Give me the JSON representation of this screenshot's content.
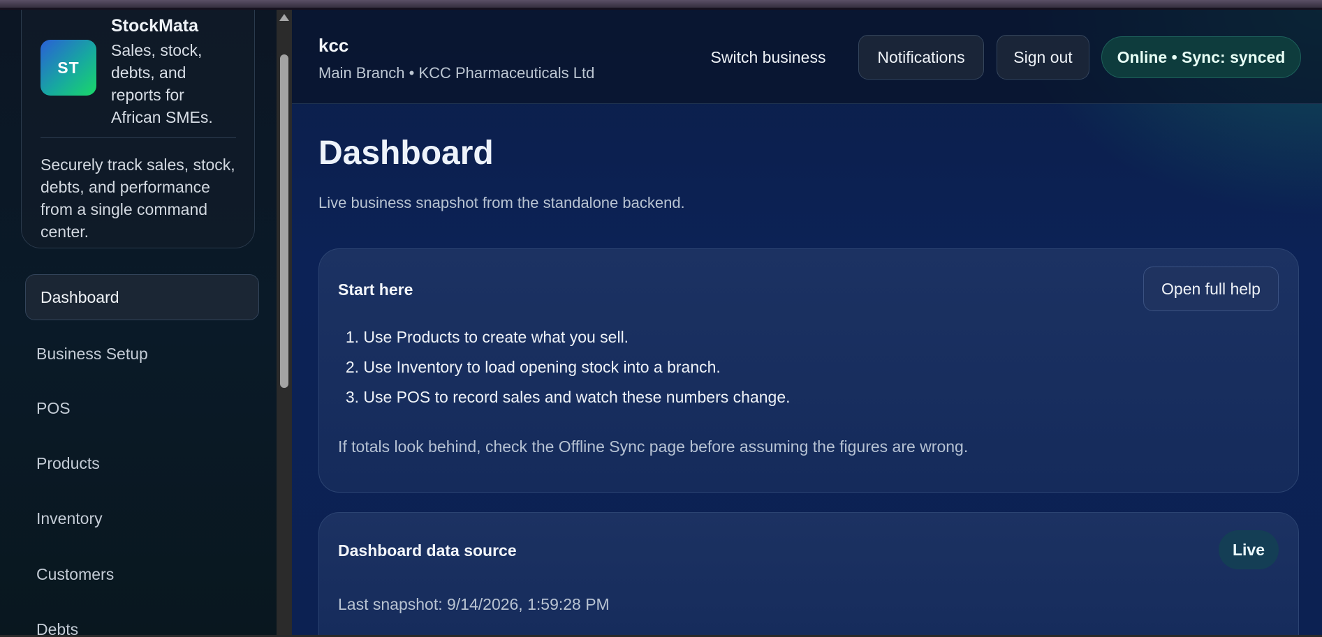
{
  "brand": {
    "logo_text": "ST",
    "name": "StockMata",
    "tagline": "Sales, stock, debts, and reports for African SMEs.",
    "description": "Securely track sales, stock, debts, and performance from a single command center."
  },
  "sidebar": {
    "items": [
      {
        "label": "Dashboard",
        "active": true
      },
      {
        "label": "Business Setup"
      },
      {
        "label": "POS"
      },
      {
        "label": "Products"
      },
      {
        "label": "Inventory"
      },
      {
        "label": "Customers"
      },
      {
        "label": "Debts"
      }
    ]
  },
  "header": {
    "business_name": "kcc",
    "business_sub": "Main Branch • KCC Pharmaceuticals Ltd",
    "switch_label": "Switch business",
    "notifications_label": "Notifications",
    "signout_label": "Sign out",
    "status_label": "Online • Sync: synced"
  },
  "page": {
    "title": "Dashboard",
    "subtitle": "Live business snapshot from the standalone backend."
  },
  "start_card": {
    "title": "Start here",
    "help_button": "Open full help",
    "steps": [
      {
        "num": "1.",
        "text": "Use Products to create what you sell."
      },
      {
        "num": "2.",
        "text": "Use Inventory to load opening stock into a branch."
      },
      {
        "num": "3.",
        "text": "Use POS to record sales and watch these numbers change."
      }
    ],
    "note": "If totals look behind, check the Offline Sync page before assuming the figures are wrong."
  },
  "source_card": {
    "title": "Dashboard data source",
    "badge": "Live",
    "snapshot": "Last snapshot: 9/14/2026, 1:59:28 PM"
  },
  "colors": {
    "accent_green": "#1ad868",
    "status_bg": "#0e3c3d",
    "main_bg": "#0c2256"
  }
}
